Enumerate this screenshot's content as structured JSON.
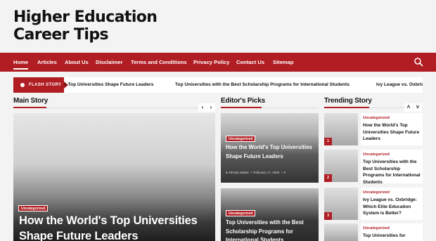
{
  "site": {
    "title_line1": "Higher Education",
    "title_line2": "Career Tips"
  },
  "nav": {
    "items": [
      "Home",
      "Articles",
      "About Us",
      "Disclaimer",
      "Terms and Conditions",
      "Privacy Policy",
      "Contact Us",
      "Sitemap"
    ],
    "active": "Home",
    "search_icon": "search-icon"
  },
  "flash": {
    "label": "FLASH STORY",
    "items": [
      "s Top Universities Shape Future Leaders",
      "Top Universities with the Best Scholarship Programs for International Students",
      "Ivy League vs. Oxbric"
    ]
  },
  "sections": {
    "main": "Main Story",
    "editors": "Editor's Picks",
    "trending": "Trending Story"
  },
  "main_story": {
    "category": "Uncategorized",
    "headline": "How the World's Top Universities Shape Future Leaders"
  },
  "editors_picks": [
    {
      "category": "Uncategorized",
      "headline": "How the World's Top Universities Shape Future Leaders",
      "author": "Ahmad Jubaer",
      "date": "February 17, 2025",
      "comments": "0"
    },
    {
      "category": "Uncategorized",
      "headline": "Top Universities with the Best Scholarship Programs for International Students"
    }
  ],
  "trending": [
    {
      "num": "1",
      "category": "Uncategorized",
      "title": "How the World's Top Universities Shape Future Leaders"
    },
    {
      "num": "2",
      "category": "Uncategorized",
      "title": "Top Universities with the Best Scholarship Programs for International Students"
    },
    {
      "num": "3",
      "category": "Uncategorized",
      "title": "Ivy League vs. Oxbridge: Which Elite Education System is Better?"
    },
    {
      "num": "4",
      "category": "Uncategorized",
      "title": "Top Universities for"
    }
  ],
  "colors": {
    "accent": "#b01d22",
    "background": "#f3f3f3"
  }
}
